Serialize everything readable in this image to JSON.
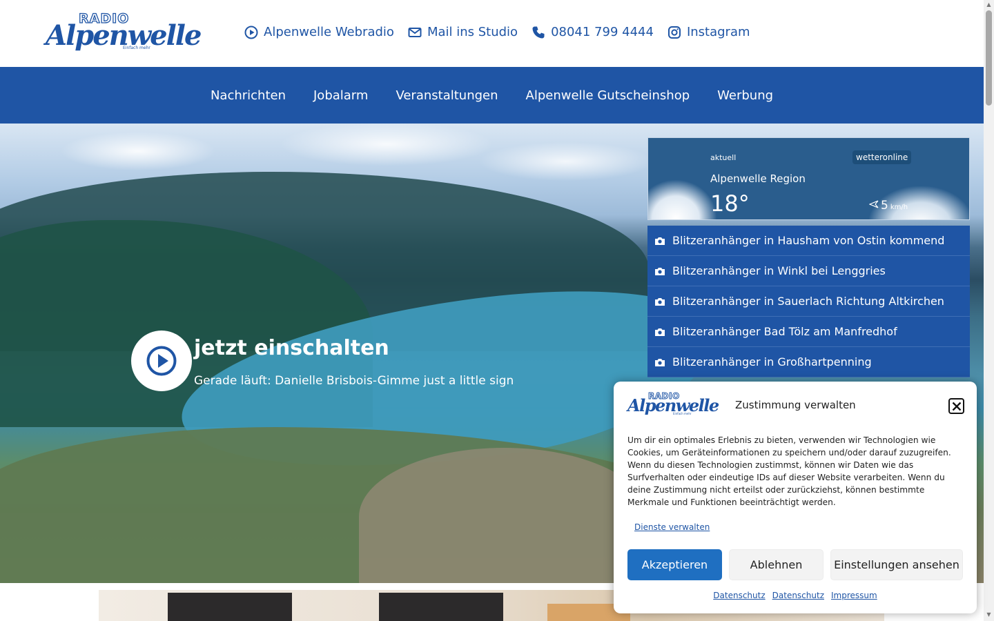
{
  "header": {
    "logo": {
      "top": "RADIO",
      "brand": "Alpenwelle",
      "tagline": "Einfach mehr"
    },
    "links": [
      {
        "label": "Alpenwelle Webradio",
        "icon": "play-circle-icon"
      },
      {
        "label": "Mail ins Studio",
        "icon": "envelope-icon"
      },
      {
        "label": "08041 799 4444",
        "icon": "phone-icon"
      },
      {
        "label": "Instagram",
        "icon": "instagram-icon"
      }
    ]
  },
  "nav": {
    "items": [
      "Nachrichten",
      "Jobalarm",
      "Veranstaltungen",
      "Alpenwelle Gutscheinshop",
      "Werbung"
    ]
  },
  "hero": {
    "title": "jetzt einschalten",
    "now_playing": "Gerade läuft: Danielle Brisbois-Gimme just a little sign"
  },
  "weather": {
    "label": "aktuell",
    "brand": "wetteronline",
    "region": "Alpenwelle Region",
    "temperature": "18°",
    "wind_speed": "5",
    "wind_unit": "km/h"
  },
  "radar": {
    "items": [
      "Blitzeranhänger in Hausham von Ostin kommend",
      "Blitzeranhänger in Winkl bei Lenggries",
      "Blitzeranhänger in Sauerlach Richtung Altkirchen",
      "Blitzeranhänger Bad Tölz am Manfredhof",
      "Blitzeranhänger in Großhartpenning"
    ]
  },
  "consent": {
    "logo": {
      "top": "RADIO",
      "brand": "Alpenwelle",
      "tagline": "Einfach mehr"
    },
    "title": "Zustimmung verwalten",
    "text": "Um dir ein optimales Erlebnis zu bieten, verwenden wir Technologien wie Cookies, um Geräteinformationen zu speichern und/oder darauf zuzugreifen. Wenn du diesen Technologien zustimmst, können wir Daten wie das Surfverhalten oder eindeutige IDs auf dieser Website verarbeiten. Wenn du deine Zustimmung nicht erteilst oder zurückziehst, können bestimmte Merkmale und Funktionen beeinträchtigt werden.",
    "manage_link": "Dienste verwalten",
    "accept": "Akzeptieren",
    "deny": "Ablehnen",
    "preferences": "Einstellungen ansehen",
    "footer_links": [
      "Datenschutz",
      "Datenschutz",
      "Impressum"
    ]
  },
  "colors": {
    "brand_blue": "#1f55a5",
    "accept_blue": "#1f6fc1"
  }
}
